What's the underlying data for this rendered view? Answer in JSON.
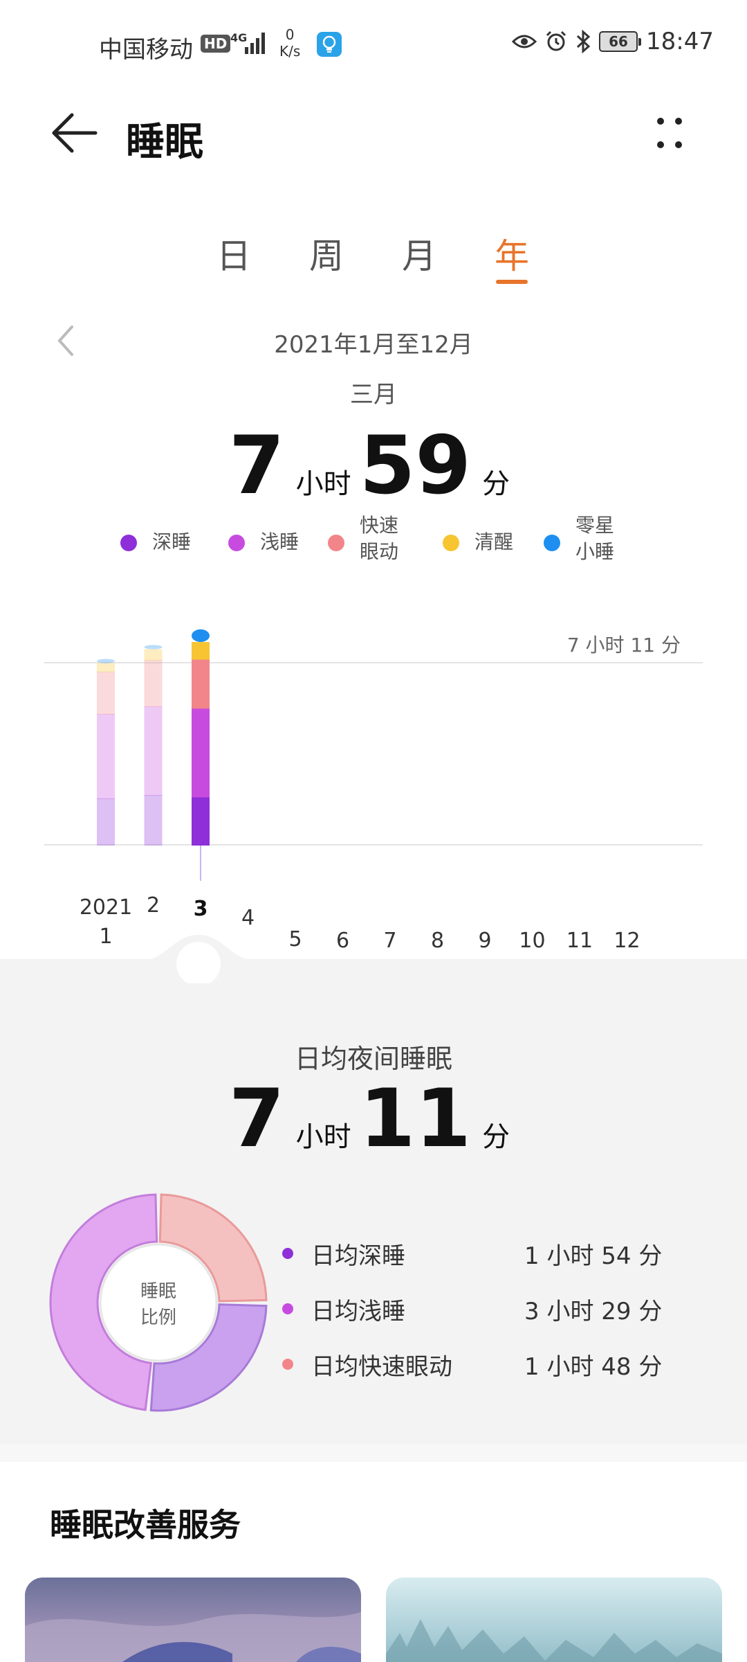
{
  "status_bar": {
    "carrier": "中国移动",
    "hd_badge": "HD",
    "network_type": "4G",
    "speed_value": "0",
    "speed_unit": "K/s",
    "battery": "66",
    "time": "18:47"
  },
  "header": {
    "title": "睡眠"
  },
  "tabs": [
    {
      "label": "日",
      "active": false
    },
    {
      "label": "周",
      "active": false
    },
    {
      "label": "月",
      "active": false
    },
    {
      "label": "年",
      "active": true
    }
  ],
  "period": {
    "range": "2021年1月至12月",
    "selected_month": "三月",
    "total": {
      "hours": "7",
      "hours_unit": "小时",
      "minutes": "59",
      "minutes_unit": "分"
    }
  },
  "legend": [
    {
      "label": "深睡",
      "color": "#8e2fd9"
    },
    {
      "label": "浅睡",
      "color": "#c84be0"
    },
    {
      "label": "快速眼动",
      "label_lines": [
        "快速",
        "眼动"
      ],
      "color": "#f2858a"
    },
    {
      "label": "清醒",
      "color": "#f7c531"
    },
    {
      "label": "零星小睡",
      "label_lines": [
        "零星",
        "小睡"
      ],
      "color": "#1e8ff0"
    }
  ],
  "chart_data": {
    "type": "bar",
    "stacked": true,
    "categories": [
      "1",
      "2",
      "3",
      "4",
      "5",
      "6",
      "7",
      "8",
      "9",
      "10",
      "11",
      "12"
    ],
    "year_label": "2021",
    "selected_index": 2,
    "reference_line": {
      "label": "7 小时 11 分",
      "value_minutes": 431
    },
    "series": [
      {
        "name": "深睡",
        "color": "#8e2fd9",
        "values": [
          110,
          118,
          114,
          null,
          null,
          null,
          null,
          null,
          null,
          null,
          null,
          null
        ]
      },
      {
        "name": "浅睡",
        "color": "#c84be0",
        "values": [
          200,
          210,
          210,
          null,
          null,
          null,
          null,
          null,
          null,
          null,
          null,
          null
        ]
      },
      {
        "name": "快速眼动",
        "color": "#f2858a",
        "values": [
          100,
          110,
          116,
          null,
          null,
          null,
          null,
          null,
          null,
          null,
          null,
          null
        ]
      },
      {
        "name": "清醒",
        "color": "#f7c531",
        "values": [
          20,
          25,
          40,
          null,
          null,
          null,
          null,
          null,
          null,
          null,
          null,
          null
        ]
      },
      {
        "name": "零星小睡",
        "color": "#1e8ff0",
        "values": [
          10,
          10,
          30,
          null,
          null,
          null,
          null,
          null,
          null,
          null,
          null,
          null
        ]
      }
    ],
    "units": "minutes",
    "colors": {
      "dimmed_opacity": 0.3,
      "grid": "#e4e4e4"
    }
  },
  "average": {
    "title": "日均夜间睡眠",
    "hours": "7",
    "hours_unit": "小时",
    "minutes": "11",
    "minutes_unit": "分"
  },
  "sleep_ratio": {
    "center_label_lines": [
      "睡眠",
      "比例"
    ],
    "segments": [
      {
        "name": "深睡",
        "value_minutes": 114,
        "color": "#c9a1ee",
        "stroke": "#a77ad8"
      },
      {
        "name": "浅睡",
        "value_minutes": 209,
        "color": "#e2a7f0",
        "stroke": "#c37ddc"
      },
      {
        "name": "快速眼动",
        "value_minutes": 108,
        "color": "#f5c0c0",
        "stroke": "#e99a9a"
      }
    ]
  },
  "breakdown": [
    {
      "label": "日均深睡",
      "value": "1 小时 54 分",
      "color": "#8e2fd9"
    },
    {
      "label": "日均浅睡",
      "value": "3 小时 29 分",
      "color": "#c84be0"
    },
    {
      "label": "日均快速眼动",
      "value": "1 小时 48 分",
      "color": "#f2858a"
    }
  ],
  "services": {
    "title": "睡眠改善服务"
  }
}
